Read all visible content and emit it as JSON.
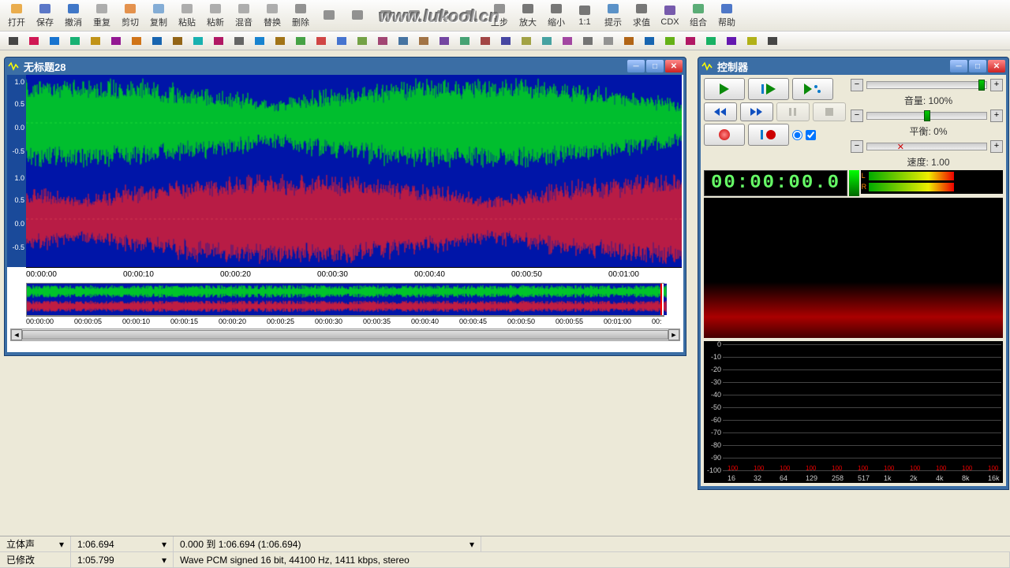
{
  "watermark": "www.lukool.cn",
  "toolbar": [
    {
      "id": "open",
      "label": "打开",
      "color": "#e8a030"
    },
    {
      "id": "save",
      "label": "保存",
      "color": "#4060c0"
    },
    {
      "id": "undo",
      "label": "撤消",
      "color": "#2060c0"
    },
    {
      "id": "redo",
      "label": "重复",
      "color": "#a0a0a0"
    },
    {
      "id": "cut",
      "label": "剪切",
      "color": "#e08030"
    },
    {
      "id": "copy",
      "label": "复制",
      "color": "#70a0d0"
    },
    {
      "id": "paste",
      "label": "粘贴",
      "color": "#a0a0a0"
    },
    {
      "id": "pastenew",
      "label": "粘新",
      "color": "#a0a0a0"
    },
    {
      "id": "mix",
      "label": "混音",
      "color": "#a0a0a0"
    },
    {
      "id": "replace",
      "label": "替换",
      "color": "#a0a0a0"
    },
    {
      "id": "delete",
      "label": "删除",
      "color": "#808080"
    },
    {
      "id": "t1",
      "label": "",
      "color": "#808080"
    },
    {
      "id": "t2",
      "label": "",
      "color": "#808080"
    },
    {
      "id": "t3",
      "label": "",
      "color": "#808080"
    },
    {
      "id": "t4",
      "label": "",
      "color": "#808080"
    },
    {
      "id": "t5",
      "label": "",
      "color": "#808080"
    },
    {
      "id": "t6",
      "label": "",
      "color": "#808080"
    },
    {
      "id": "prev",
      "label": "上步",
      "color": "#808080"
    },
    {
      "id": "zoomin",
      "label": "放大",
      "color": "#606060"
    },
    {
      "id": "zoomout",
      "label": "缩小",
      "color": "#606060"
    },
    {
      "id": "oneone",
      "label": "1:1",
      "color": "#606060"
    },
    {
      "id": "hint",
      "label": "提示",
      "color": "#4080c0"
    },
    {
      "id": "eval",
      "label": "求值",
      "color": "#606060"
    },
    {
      "id": "cdx",
      "label": "CDX",
      "color": "#6040a0"
    },
    {
      "id": "group",
      "label": "组合",
      "color": "#40a060"
    },
    {
      "id": "help",
      "label": "帮助",
      "color": "#3060c0"
    }
  ],
  "wave_window": {
    "title": "无标题28"
  },
  "ctrl_window": {
    "title": "控制器"
  },
  "main_axis_y": [
    "1.0",
    "0.5",
    "0.0",
    "-0.5"
  ],
  "main_ruler": [
    "00:00:00",
    "00:00:10",
    "00:00:20",
    "00:00:30",
    "00:00:40",
    "00:00:50",
    "00:01:00"
  ],
  "overview_ruler": [
    "00:00:00",
    "00:00:05",
    "00:00:10",
    "00:00:15",
    "00:00:20",
    "00:00:25",
    "00:00:30",
    "00:00:35",
    "00:00:40",
    "00:00:45",
    "00:00:50",
    "00:00:55",
    "00:01:00",
    "00:"
  ],
  "controller": {
    "volume_label": "音量: 100%",
    "balance_label": "平衡: 0%",
    "speed_label": "速度: 1.00",
    "timecode": "00:00:00.0"
  },
  "spectrum_y": [
    "0",
    "-10",
    "-20",
    "-30",
    "-40",
    "-50",
    "-60",
    "-70",
    "-80",
    "-90",
    "-100"
  ],
  "spectrum_x": [
    "16",
    "32",
    "64",
    "129",
    "258",
    "517",
    "1k",
    "2k",
    "4k",
    "8k",
    "16k"
  ],
  "spectrum_peak": "100",
  "status": {
    "channels_label": "立体声",
    "duration1": "1:06.694",
    "selection": "0.000 到 1:06.694 (1:06.694)",
    "modified": "已修改",
    "duration2": "1:05.799",
    "format": "Wave PCM signed 16 bit, 44100 Hz, 1411 kbps, stereo"
  },
  "chart_data": {
    "type": "waveform",
    "channels": 2,
    "sample_rate_hz": 44100,
    "duration_s": 66.694,
    "y_range": [
      -1.0,
      1.0
    ],
    "channel_colors": [
      "#00ff00",
      "#ff2020"
    ],
    "note": "dense audio waveform; peaks span roughly -0.8..0.9 throughout"
  }
}
